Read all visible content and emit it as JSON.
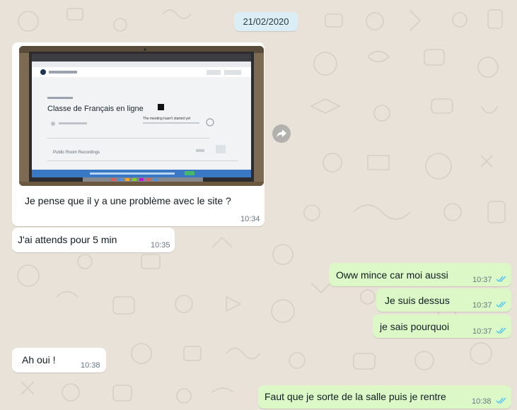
{
  "date_chip": "21/02/2020",
  "image_message": {
    "screen_title": "Classe de Français en ligne",
    "screen_notice": "The meeting hasn't started yet",
    "screen_recordings": "Public Room Recordings",
    "caption": "Je pense que il y a une problème avec le site ?",
    "time": "10:34"
  },
  "messages": [
    {
      "direction": "in",
      "text": "J'ai attends pour 5 min",
      "time": "10:35"
    },
    {
      "direction": "out",
      "text": "Oww mince car moi aussi",
      "time": "10:37"
    },
    {
      "direction": "out",
      "text": "Je suis dessus",
      "time": "10:37"
    },
    {
      "direction": "out",
      "text": "je sais pourquoi",
      "time": "10:37"
    },
    {
      "direction": "in",
      "text": "Ah oui !",
      "time": "10:38"
    },
    {
      "direction": "out",
      "text": "Faut que je sorte de la salle puis je rentre",
      "time": "10:38"
    }
  ],
  "colors": {
    "incoming": "#ffffff",
    "outgoing": "#dcf8c6",
    "read_ticks": "#4fc3f7",
    "date_chip": "#dceef5",
    "background": "#e9e2d8"
  },
  "icons": {
    "forward": "forward-arrow-icon",
    "read_receipt": "double-check-icon"
  }
}
